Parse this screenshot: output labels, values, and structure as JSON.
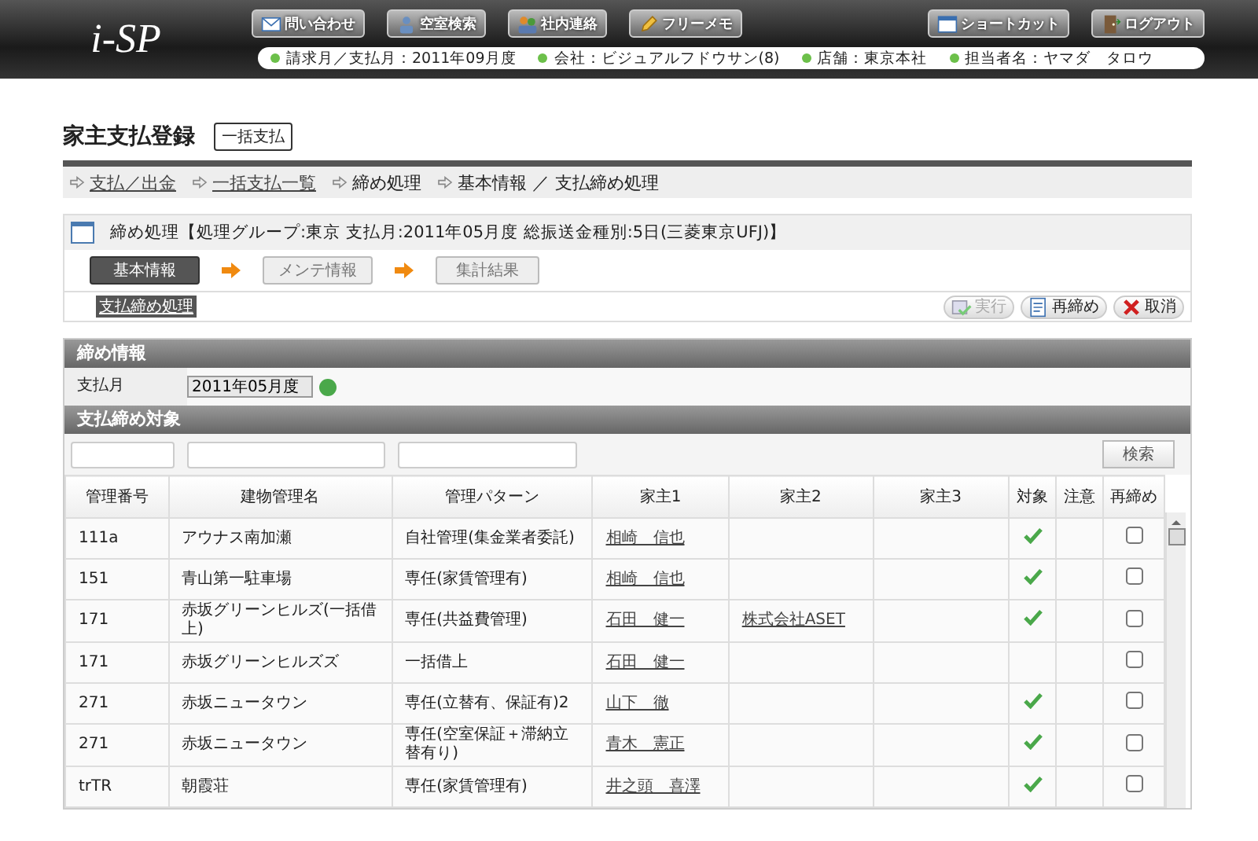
{
  "header": {
    "logo": "i-SP",
    "nav_buttons": [
      {
        "label": "問い合わせ"
      },
      {
        "label": "空室検索"
      },
      {
        "label": "社内連絡"
      },
      {
        "label": "フリーメモ"
      }
    ],
    "right_buttons": [
      {
        "label": "ショートカット"
      },
      {
        "label": "ログアウト"
      }
    ],
    "info": [
      "請求月／支払月：2011年09月度",
      "会社：ビジュアルフドウサン(8)",
      "店舗：東京本社",
      "担当者名：ヤマダ　タロウ"
    ]
  },
  "page": {
    "title": "家主支払登録",
    "mode_badge": "一括支払"
  },
  "breadcrumb": [
    {
      "label": "支払／出金",
      "link": true
    },
    {
      "label": "一括支払一覧",
      "link": true
    },
    {
      "label": "締め処理",
      "link": false
    },
    {
      "label": "基本情報 ／ 支払締め処理",
      "link": false
    }
  ],
  "process": {
    "title": "締め処理【処理グループ:東京 支払月:2011年05月度 総振送金種別:5日(三菱東京UFJ)】",
    "steps": [
      {
        "label": "基本情報",
        "selected": true
      },
      {
        "label": "メンテ情報",
        "selected": false
      },
      {
        "label": "集計結果",
        "selected": false
      }
    ],
    "sub_label": "支払締め処理",
    "actions": [
      {
        "label": "実行",
        "disabled": true
      },
      {
        "label": "再締め",
        "disabled": false
      },
      {
        "label": "取消",
        "disabled": false
      }
    ]
  },
  "close_info": {
    "heading": "締め情報",
    "field_label": "支払月",
    "value": "2011年05月度",
    "valid": true
  },
  "targets": {
    "heading": "支払締め対象",
    "filters": [
      {
        "kind": "text"
      },
      {
        "kind": "text"
      },
      {
        "kind": "text"
      }
    ],
    "search_button": "検索",
    "columns": [
      "管理番号",
      "建物管理名",
      "管理パターン",
      "家主1",
      "家主2",
      "家主3",
      "対象",
      "注意",
      "再締め"
    ],
    "rows": [
      {
        "code": "111a",
        "building": "アウナス南加瀬",
        "pattern": "自社管理(集金業者委託)",
        "owner1": "相崎　信也",
        "owner2": "",
        "target": true,
        "recheck": false
      },
      {
        "code": "151",
        "building": "青山第一駐車場",
        "pattern": "専任(家賃管理有)",
        "owner1": "相崎　信也",
        "owner2": "",
        "target": true,
        "recheck": false
      },
      {
        "code": "171",
        "building": "赤坂グリーンヒルズ(一括借上)",
        "pattern": "専任(共益費管理)",
        "owner1": "石田　健一",
        "owner2": "株式会社ASET",
        "target": true,
        "recheck": false
      },
      {
        "code": "171",
        "building": "赤坂グリーンヒルズズ",
        "pattern": "一括借上",
        "owner1": "石田　健一",
        "owner2": "",
        "target": false,
        "recheck": false
      },
      {
        "code": "271",
        "building": "赤坂ニュータウン",
        "pattern": "専任(立替有、保証有)2",
        "owner1": "山下　徹",
        "owner2": "",
        "target": true,
        "recheck": false
      },
      {
        "code": "271",
        "building": "赤坂ニュータウン",
        "pattern": "専任(空室保証＋滞納立替有り)",
        "owner1": "青木　憲正",
        "owner2": "",
        "target": true,
        "recheck": false
      },
      {
        "code": "trTR",
        "building": "朝霞荘",
        "pattern": "専任(家賃管理有)",
        "owner1": "井之頭　喜澤",
        "owner2": "",
        "target": true,
        "recheck": false
      }
    ]
  }
}
